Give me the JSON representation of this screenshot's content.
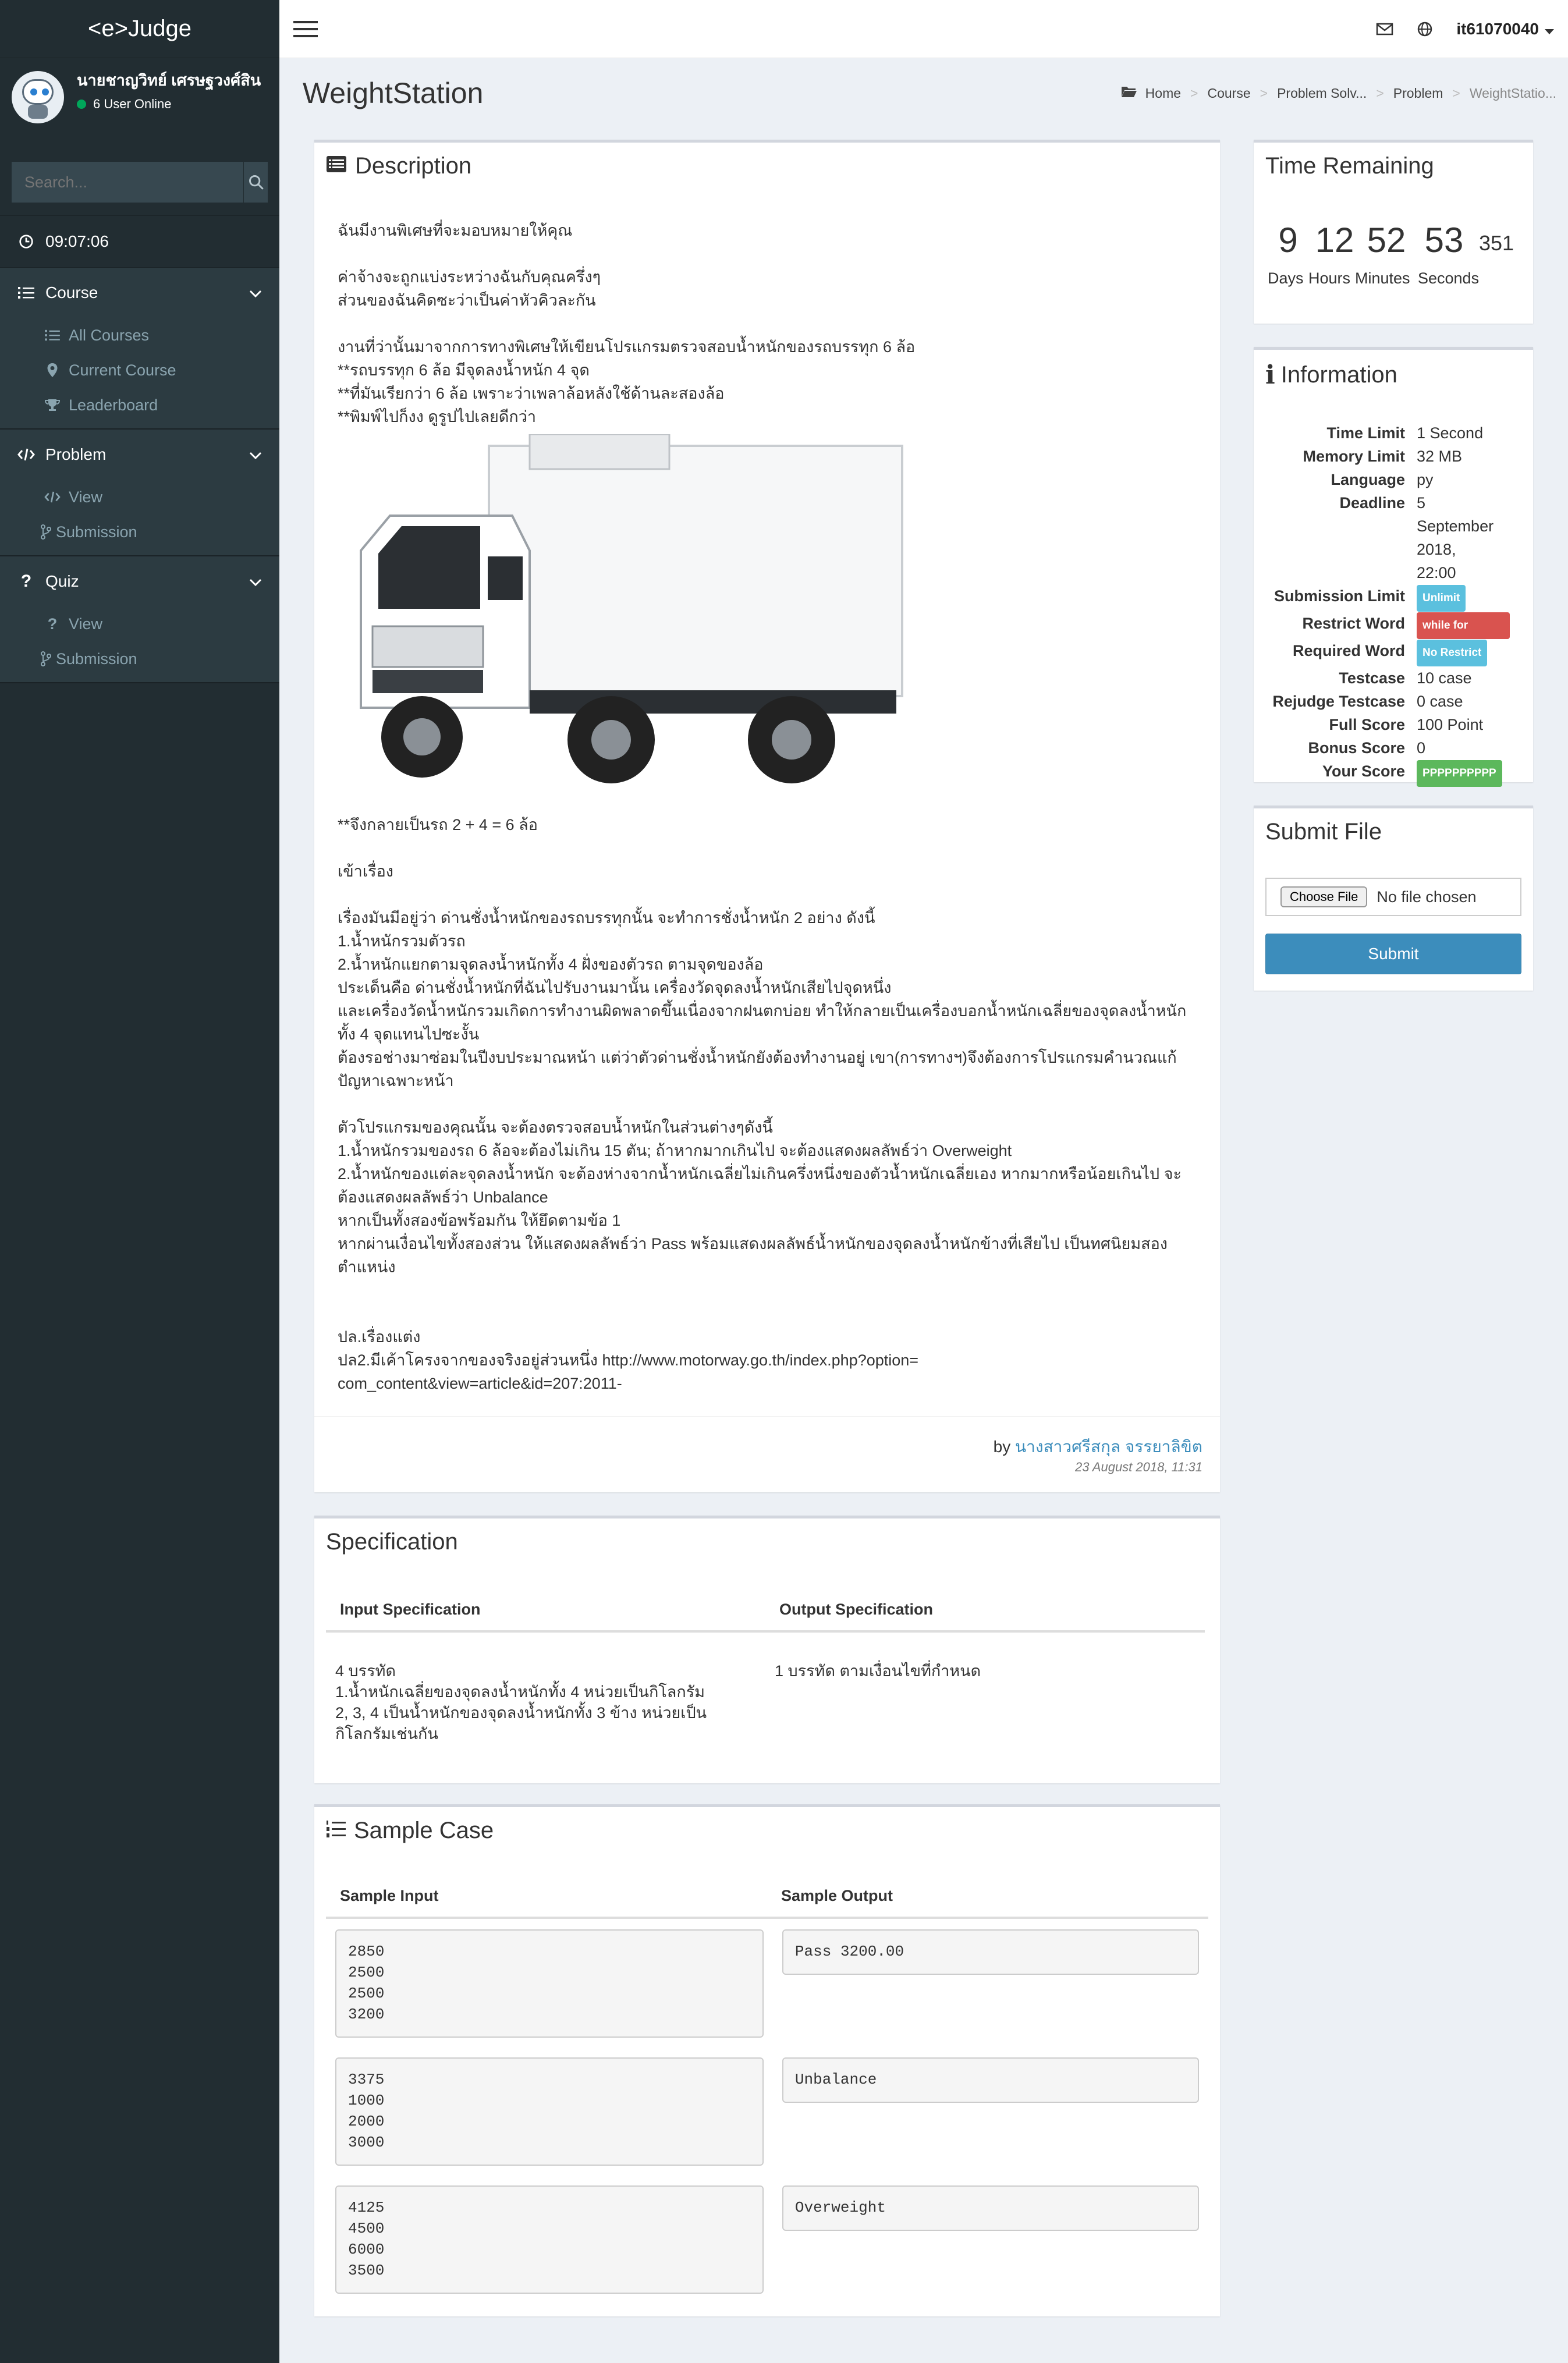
{
  "app": {
    "logo": "<e>Judge"
  },
  "user": {
    "name": "นายชาญวิทย์ เศรษฐวงศ์สิน",
    "online": "6 User Online",
    "id": "it61070040"
  },
  "search": {
    "placeholder": "Search..."
  },
  "clock": "09:07:06",
  "sidebar": {
    "course": {
      "label": "Course",
      "items": [
        "All Courses",
        "Current Course",
        "Leaderboard"
      ]
    },
    "problem": {
      "label": "Problem",
      "items": [
        "View",
        "Submission"
      ]
    },
    "quiz": {
      "label": "Quiz",
      "items": [
        "View",
        "Submission"
      ]
    }
  },
  "page": {
    "title": "WeightStation"
  },
  "breadcrumb": [
    "Home",
    "Course",
    "Problem Solv...",
    "Problem",
    "WeightStatio..."
  ],
  "description": {
    "title": "Description",
    "p1": "ฉันมีงานพิเศษที่จะมอบหมายให้คุณ",
    "p2a": "ค่าจ้างจะถูกแบ่งระหว่างฉันกับคุณครึ่งๆ",
    "p2b": "ส่วนของฉันคิดซะว่าเป็นค่าหัวคิวละกัน",
    "p3a": "งานที่ว่านั้นมาจากการทางพิเศษให้เขียนโปรแกรมตรวจสอบน้ำหนักของรถบรรทุก 6 ล้อ",
    "p3b": "**รถบรรทุก 6 ล้อ มีจุดลงน้ำหนัก 4 จุด",
    "p3c": "**ที่มันเรียกว่า 6 ล้อ เพราะว่าเพลาล้อหลังใช้ด้านละสองล้อ",
    "p3d": "**พิมพ์ไปก็งง ดูรูปไปเลยดีกว่า",
    "p4": "**จึงกลายเป็นรถ 2 + 4 = 6 ล้อ",
    "p5": "เข้าเรื่อง",
    "p6a": "เรื่องมันมีอยู่ว่า ด่านชั่งน้ำหนักของรถบรรทุกนั้น จะทำการชั่งน้ำหนัก 2 อย่าง ดังนี้",
    "p6b": "1.น้ำหนักรวมตัวรถ",
    "p6c": "2.น้ำหนักแยกตามจุดลงน้ำหนักทั้ง 4 ฝั่งของตัวรถ ตามจุดของล้อ",
    "p6d": "ประเด็นคือ ด่านชั่งน้ำหนักที่ฉันไปรับงานมานั้น เครื่องวัดจุดลงน้ำหนักเสียไปจุดหนึ่ง",
    "p6e": "และเครื่องวัดน้ำหนักรวมเกิดการทำงานผิดพลาดขึ้นเนื่องจากฝนตกบ่อย ทำให้กลายเป็นเครื่องบอกน้ำหนักเฉลี่ยของจุดลงน้ำหนักทั้ง 4 จุดแทนไปซะงั้น",
    "p6f": "ต้องรอช่างมาซ่อมในปีงบประมาณหน้า แต่ว่าตัวด่านชั่งน้ำหนักยังต้องทำงานอยู่ เขา(การทางฯ)จึงต้องการโปรแกรมคำนวณแก้ปัญหาเฉพาะหน้า",
    "p7a": "ตัวโปรแกรมของคุณนั้น จะต้องตรวจสอบน้ำหนักในส่วนต่างๆดังนี้",
    "p7b": "1.น้ำหนักรวมของรถ 6 ล้อจะต้องไม่เกิน 15 ตัน; ถ้าหากมากเกินไป จะต้องแสดงผลลัพธ์ว่า Overweight",
    "p7c": "2.น้ำหนักของแต่ละจุดลงน้ำหนัก จะต้องห่างจากน้ำหนักเฉลี่ยไม่เกินครึ่งหนึ่งของตัวน้ำหนักเฉลี่ยเอง หากมากหรือน้อยเกินไป จะต้องแสดงผลลัพธ์ว่า Unbalance",
    "p7d": "หากเป็นทั้งสองข้อพร้อมกัน ให้ยึดตามข้อ 1",
    "p7e": "หากผ่านเงื่อนไขทั้งสองส่วน ให้แสดงผลลัพธ์ว่า Pass พร้อมแสดงผลลัพธ์น้ำหนักของจุดลงน้ำหนักข้างที่เสียไป เป็นทศนิยมสองตำแหน่ง",
    "p8a": "ปล.เรื่องแต่ง",
    "p8b": "ปล2.มีเค้าโครงจากของจริงอยู่ส่วนหนึ่ง http://www.motorway.go.th/index.php?option=com_content&view=article&id=207:2011-",
    "by_prefix": "by",
    "author": "นางสาวศรีสกุล จรรยาลิขิต",
    "date": "23 August 2018, 11:31"
  },
  "specification": {
    "title": "Specification",
    "input_header": "Input Specification",
    "output_header": "Output Specification",
    "input_l1": "4 บรรทัด",
    "input_l2": "1.น้ำหนักเฉลี่ยของจุดลงน้ำหนักทั้ง 4 หน่วยเป็นกิโลกรัม",
    "input_l3": "2, 3, 4 เป็นน้ำหนักของจุดลงน้ำหนักทั้ง 3 ข้าง หน่วยเป็นกิโลกรัมเช่นกัน",
    "output_l1": "1 บรรทัด ตามเงื่อนไขที่กำหนด"
  },
  "sample": {
    "title": "Sample Case",
    "input_header": "Sample Input",
    "output_header": "Sample Output",
    "cases": [
      {
        "input": "2850\n2500\n2500\n3200",
        "output": "Pass 3200.00"
      },
      {
        "input": "3375\n1000\n2000\n3000",
        "output": "Unbalance"
      },
      {
        "input": "4125\n4500\n6000\n3500",
        "output": "Overweight"
      }
    ]
  },
  "time_remaining": {
    "title": "Time Remaining",
    "days": "9",
    "hours": "12",
    "minutes": "52",
    "seconds": "53",
    "ms": "351",
    "days_label": "Days",
    "hours_label": "Hours",
    "minutes_label": "Minutes",
    "seconds_label": "Seconds"
  },
  "information": {
    "title": "Information",
    "rows": [
      {
        "k": "Time Limit",
        "v": "1 Second"
      },
      {
        "k": "Memory Limit",
        "v": "32 MB"
      },
      {
        "k": "Language",
        "v": "py"
      },
      {
        "k": "Deadline",
        "v": "5 September 2018, 22:00"
      }
    ],
    "submission_limit_k": "Submission Limit",
    "submission_limit_v": "Unlimit",
    "restrict_word_k": "Restrict Word",
    "restrict_word_v": "while for",
    "required_word_k": "Required Word",
    "required_word_v": "No Restrict",
    "rows2": [
      {
        "k": "Testcase",
        "v": "10 case"
      },
      {
        "k": "Rejudge Testcase",
        "v": "0 case"
      },
      {
        "k": "Full Score",
        "v": "100 Point"
      },
      {
        "k": "Bonus Score",
        "v": "0"
      }
    ],
    "your_score_k": "Your Score",
    "your_score_v": "PPPPPPPPPP"
  },
  "submit": {
    "title": "Submit File",
    "choose": "Choose File",
    "no_file": "No file chosen",
    "button": "Submit"
  },
  "colors": {
    "sidebar": "#222d32",
    "accent": "#3c8dbc",
    "bg": "#ecf0f5"
  }
}
